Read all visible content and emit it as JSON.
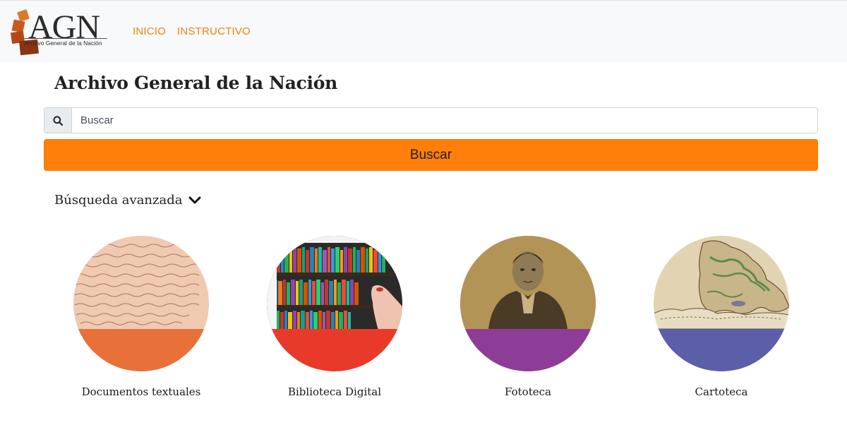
{
  "brand": {
    "logo_text": "AGN",
    "logo_subtitle": "Archivo General de la Nación"
  },
  "nav": {
    "items": [
      "INICIO",
      "INSTRUCTIVO"
    ]
  },
  "page": {
    "title": "Archivo General de la Nación"
  },
  "search": {
    "placeholder": "Buscar",
    "button_label": "Buscar",
    "icon": "search-icon"
  },
  "advanced": {
    "label": "Búsqueda avanzada",
    "icon": "chevron-down-icon"
  },
  "categories": [
    {
      "label": "Documentos textuales",
      "color": "#e8713a"
    },
    {
      "label": "Biblioteca Digital",
      "color": "#e83a2a"
    },
    {
      "label": "Fototeca",
      "color": "#8e3d96"
    },
    {
      "label": "Cartoteca",
      "color": "#5a5fa8"
    }
  ],
  "colors": {
    "accent": "#ff7f0a",
    "nav_link": "#f47f0f"
  }
}
